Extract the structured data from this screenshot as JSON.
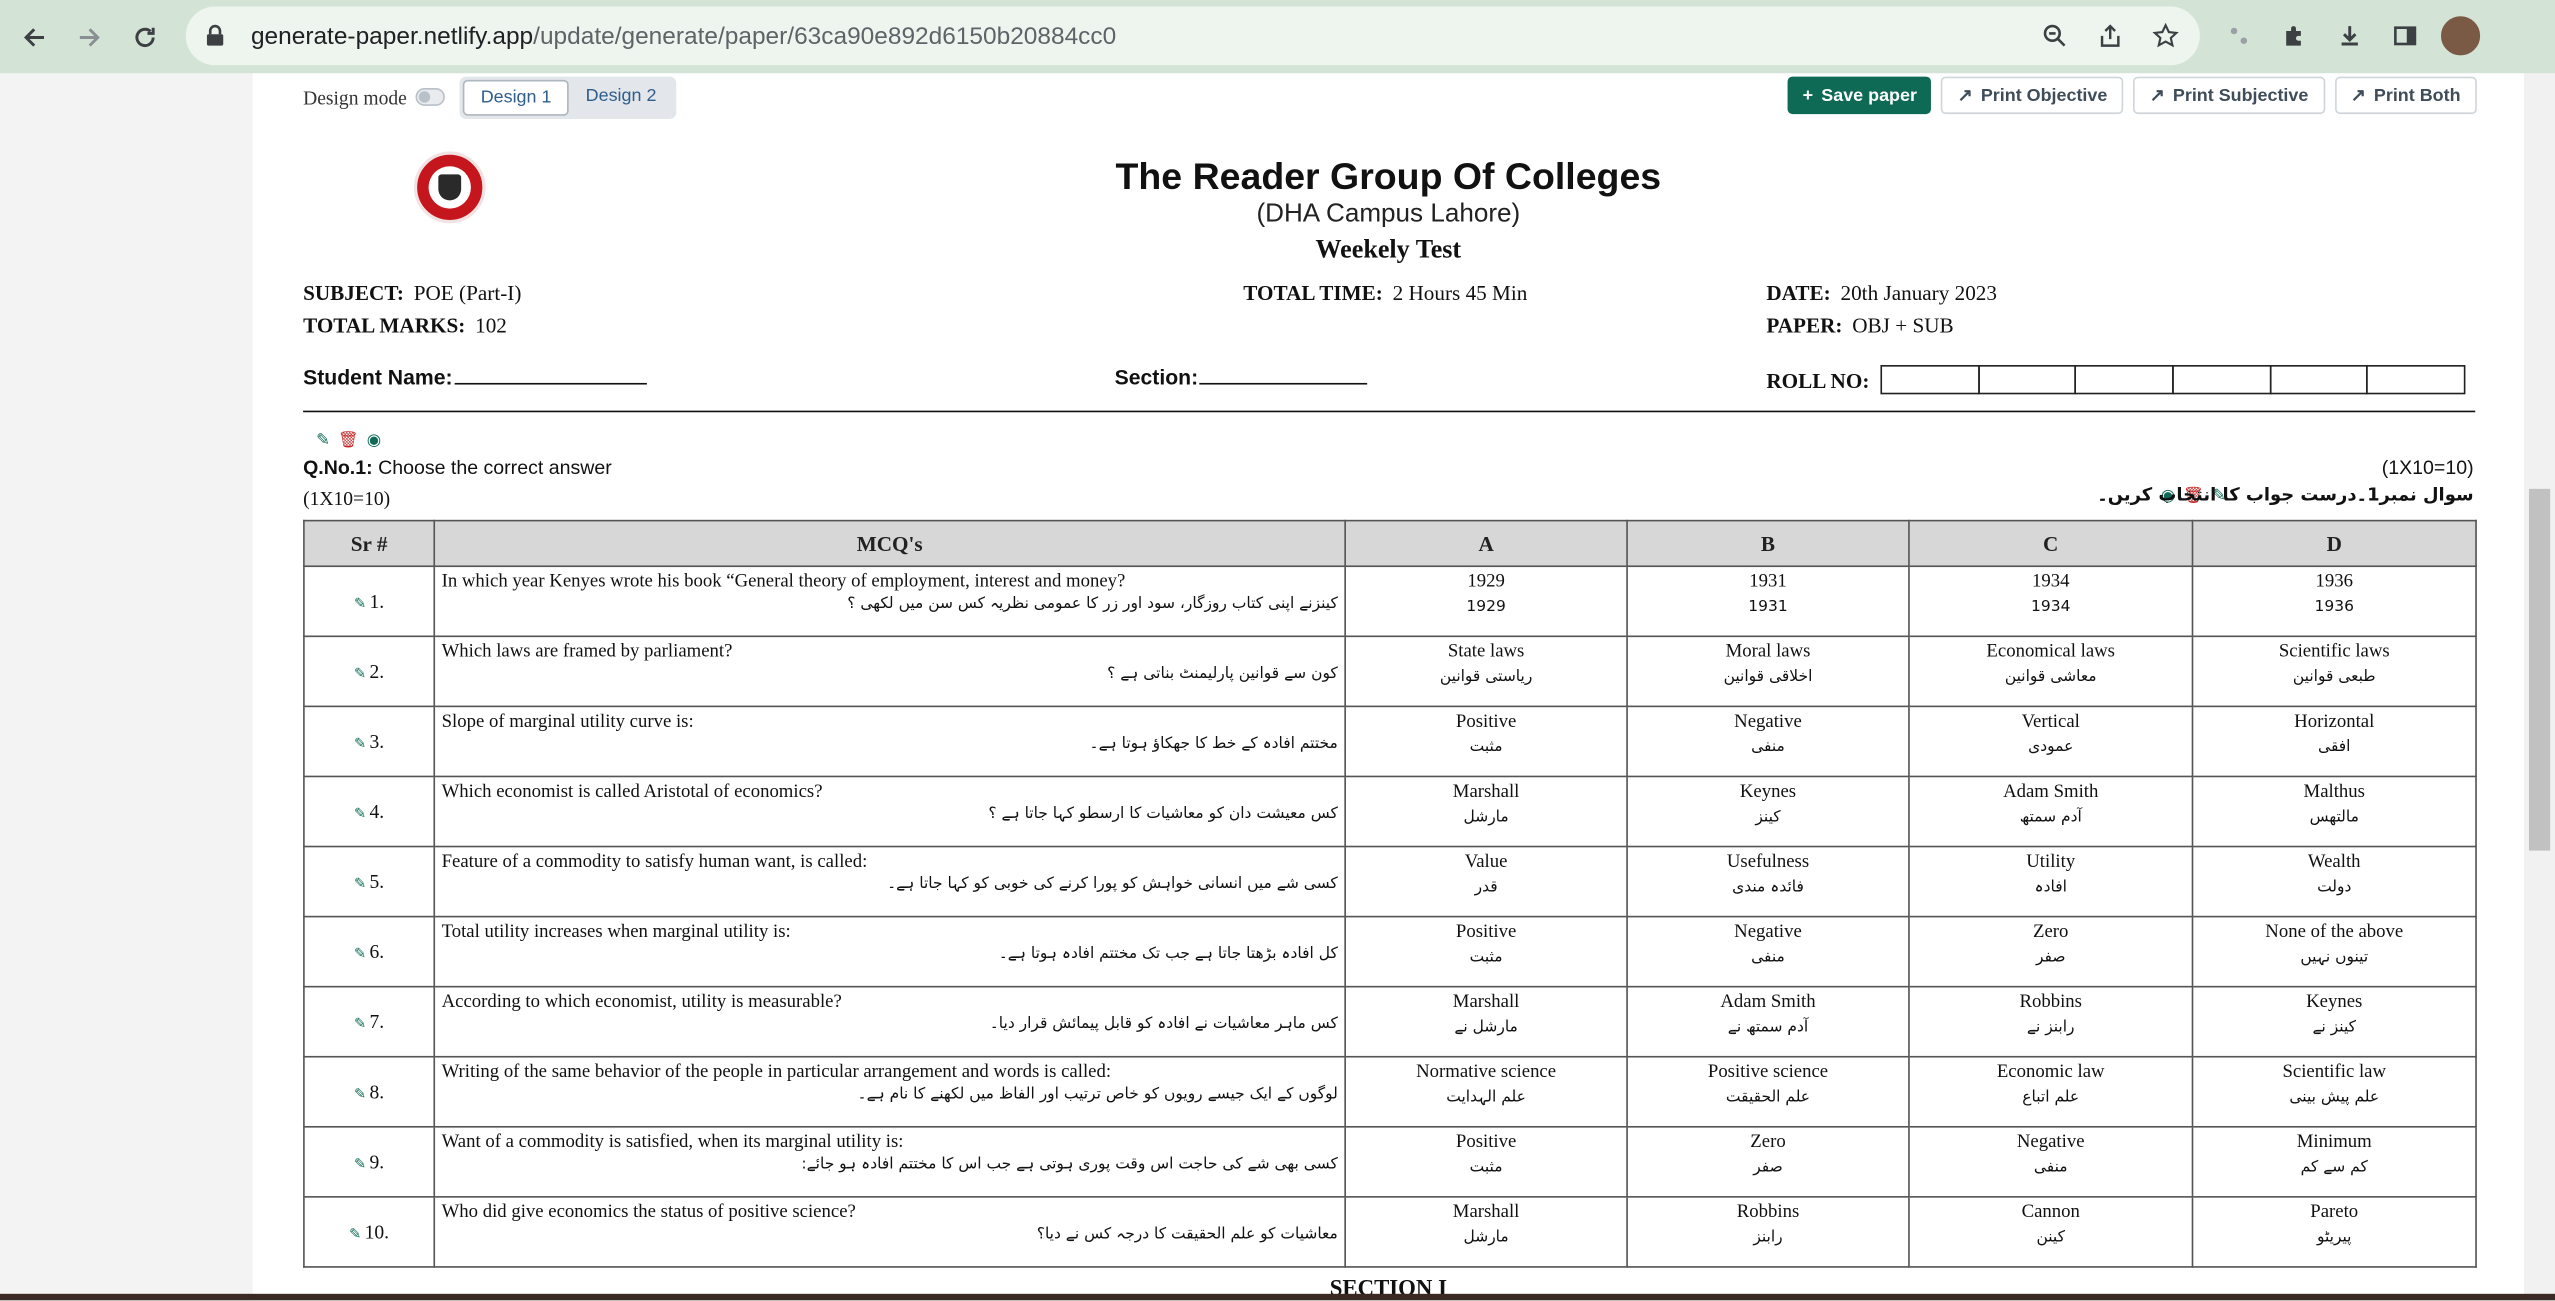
{
  "browser": {
    "url_host": "generate-paper.netlify.app",
    "url_path": "/update/generate/paper/63ca90e892d6150b20884cc0"
  },
  "toolbar": {
    "design_mode_label": "Design mode",
    "design_tabs": [
      "Design 1",
      "Design 2"
    ],
    "save_label": "Save paper",
    "print_objective_label": "Print Objective",
    "print_subjective_label": "Print Subjective",
    "print_both_label": "Print Both"
  },
  "header": {
    "college": "The Reader Group Of Colleges",
    "campus": "(DHA Campus Lahore)",
    "test": "Weekely Test"
  },
  "meta": {
    "subject_label": "SUBJECT:",
    "subject": "POE (Part-I)",
    "total_time_label": "TOTAL TIME:",
    "total_time": "2 Hours 45 Min",
    "date_label": "DATE:",
    "date": "20th January 2023",
    "total_marks_label": "TOTAL MARKS:",
    "total_marks": "102",
    "paper_label": "PAPER:",
    "paper": "OBJ + SUB",
    "student_name_label": "Student Name:",
    "section_label": "Section:",
    "roll_no_label": "ROLL NO:"
  },
  "question": {
    "label": "Q.No.1:",
    "text": "Choose the correct answer",
    "marks": "(1X10=10)",
    "urdu": "سوال نمبر1۔درست جواب کا انتخاب کریں۔"
  },
  "table": {
    "headers": [
      "Sr #",
      "MCQ's",
      "A",
      "B",
      "C",
      "D"
    ],
    "rows": [
      {
        "sr": "1.",
        "q_en": "In which year Kenyes wrote his book “General theory of employment, interest and money?",
        "q_ur": "کینزنے اپنی کتاب روزگار، سود اور زر کا عمومی نظریہ کس سن میں لکھی ؟",
        "a": [
          "1929",
          "1929"
        ],
        "b": [
          "1931",
          "1931"
        ],
        "c": [
          "1934",
          "1934"
        ],
        "d": [
          "1936",
          "1936"
        ]
      },
      {
        "sr": "2.",
        "q_en": "Which laws are framed by parliament?",
        "q_ur": "کون سے قوانین پارلیمنٹ بناتی ہے ؟",
        "a": [
          "State laws",
          "ریاستی قوانین"
        ],
        "b": [
          "Moral laws",
          "اخلاقی قوانین"
        ],
        "c": [
          "Economical laws",
          "معاشی قوانین"
        ],
        "d": [
          "Scientific laws",
          "طبعی قوانین"
        ]
      },
      {
        "sr": "3.",
        "q_en": "Slope of marginal utility curve is:",
        "q_ur": "مختتم افادہ کے خط کا جھکاؤ ہوتا ہے۔",
        "a": [
          "Positive",
          "مثبت"
        ],
        "b": [
          "Negative",
          "منفی"
        ],
        "c": [
          "Vertical",
          "عمودی"
        ],
        "d": [
          "Horizontal",
          "افقی"
        ]
      },
      {
        "sr": "4.",
        "q_en": "Which economist is called Aristotal of economics?",
        "q_ur": "کس معیشت دان کو معاشیات کا ارسطو کہا جاتا ہے ؟",
        "a": [
          "Marshall",
          "مارشل"
        ],
        "b": [
          "Keynes",
          "کینز"
        ],
        "c": [
          "Adam Smith",
          "آدم سمتھ"
        ],
        "d": [
          "Malthus",
          "مالتھس"
        ]
      },
      {
        "sr": "5.",
        "q_en": "Feature of a commodity to satisfy human want, is called:",
        "q_ur": "کسی شے میں انسانی خواہش کو پورا کرنے کی خوبی کو کہا جاتا ہے۔",
        "a": [
          "Value",
          "قدر"
        ],
        "b": [
          "Usefulness",
          "فائدہ مندی"
        ],
        "c": [
          "Utility",
          "افادہ"
        ],
        "d": [
          "Wealth",
          "دولت"
        ]
      },
      {
        "sr": "6.",
        "q_en": "Total utility increases when marginal utility is:",
        "q_ur": "کل افادہ بڑھتا جاتا ہے جب تک مختتم افادہ ہوتا ہے۔",
        "a": [
          "Positive",
          "مثبت"
        ],
        "b": [
          "Negative",
          "منفی"
        ],
        "c": [
          "Zero",
          "صفر"
        ],
        "d": [
          "None of the above",
          "تینوں نہیں"
        ]
      },
      {
        "sr": "7.",
        "q_en": "According to which economist, utility is measurable?",
        "q_ur": "کس ماہر معاشیات نے افادہ کو قابل پیمائش قرار دیا۔",
        "a": [
          "Marshall",
          "مارشل نے"
        ],
        "b": [
          "Adam Smith",
          "آدم سمتھ نے"
        ],
        "c": [
          "Robbins",
          "رابنز نے"
        ],
        "d": [
          "Keynes",
          "کینز نے"
        ]
      },
      {
        "sr": "8.",
        "q_en": "Writing of the same behavior of the people in particular arrangement and words is called:",
        "q_ur": "لوگوں کے ایک جیسے رویوں کو خاص ترتیب اور الفاظ میں لکھنے کا نام ہے۔",
        "a": [
          "Normative science",
          "علم الہدایت"
        ],
        "b": [
          "Positive science",
          "علم الحقیقت"
        ],
        "c": [
          "Economic law",
          "علم اتباع"
        ],
        "d": [
          "Scientific law",
          "علم پیش بینی"
        ]
      },
      {
        "sr": "9.",
        "q_en": "Want of a commodity is satisfied, when its marginal utility is:",
        "q_ur": "کسی بھی شے کی حاجت اس وقت پوری ہوتی ہے جب اس کا مختتم افادہ ہو جائے:",
        "a": [
          "Positive",
          "مثبت"
        ],
        "b": [
          "Zero",
          "صفر"
        ],
        "c": [
          "Negative",
          "منفی"
        ],
        "d": [
          "Minimum",
          "کم سے کم"
        ]
      },
      {
        "sr": "10.",
        "q_en": "Who did give economics the status of positive science?",
        "q_ur": "معاشیات کو علم الحقیقت کا درجہ کس نے دیا؟",
        "a": [
          "Marshall",
          "مارشل"
        ],
        "b": [
          "Robbins",
          "رابنز"
        ],
        "c": [
          "Cannon",
          "کینن"
        ],
        "d": [
          "Pareto",
          "پیریٹو"
        ]
      }
    ]
  },
  "next_section": "SECTION I"
}
